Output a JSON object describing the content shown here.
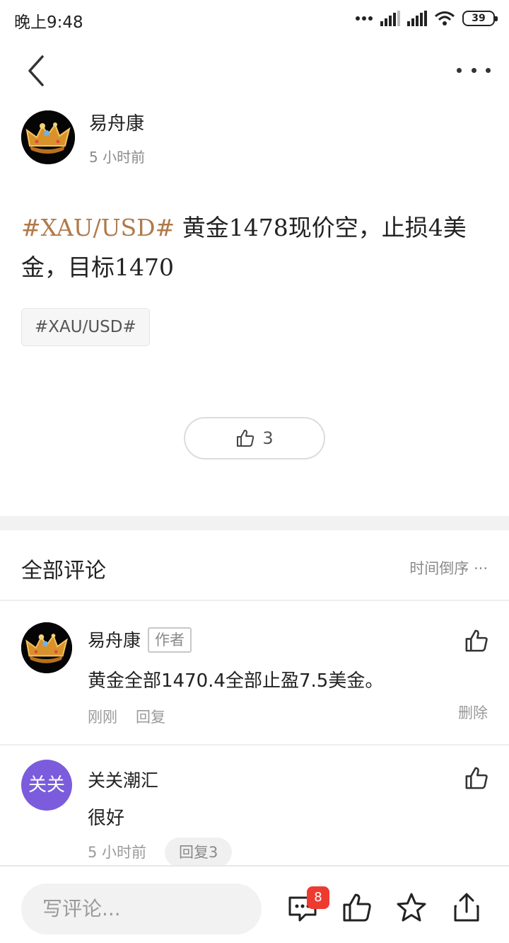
{
  "status_bar": {
    "time": "晚上9:48",
    "battery": "39",
    "icons": [
      "dots-icon",
      "signal-icon",
      "signal-icon",
      "wifi-icon",
      "battery-icon"
    ]
  },
  "nav": {
    "back_icon": "chevron-left-icon",
    "more_icon": "more-horizontal-icon"
  },
  "post": {
    "author": "易舟康",
    "time": "5 小时前",
    "hashtag": "#XAU/USD#",
    "text": " 黄金1478现价空，止损4美金，目标1470",
    "tag": "#XAU/USD#",
    "like_count": "3",
    "hashtag_color": "#b07a4a"
  },
  "comments_section": {
    "title": "全部评论",
    "sort": "时间倒序 ···"
  },
  "comments": [
    {
      "name": "易舟康",
      "badge": "作者",
      "text": "黄金全部1470.4全部止盈7.5美金。",
      "time": "刚刚",
      "reply": "回复",
      "delete": "删除"
    },
    {
      "name": "关关潮汇",
      "avatar_text": "关关",
      "avatar_color": "#7b5cdc",
      "text": "很好",
      "time": "5 小时前",
      "reply": "回复3"
    }
  ],
  "bottom_bar": {
    "placeholder": "写评论...",
    "comment_badge": "8",
    "icons": [
      "comment-icon",
      "thumbs-up-icon",
      "star-icon",
      "share-icon"
    ]
  }
}
